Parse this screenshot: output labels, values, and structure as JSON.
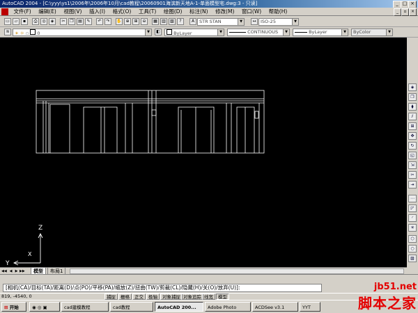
{
  "window": {
    "title": "AutoCAD 2004 - [C:\\yyy\\ys1\\2006年\\2006年10月\\cad教程\\20060901海滨新天地A-1-单面模型宅.dwg:3 - 只读]"
  },
  "menu": {
    "items": [
      "文件(F)",
      "编辑(E)",
      "视图(V)",
      "插入(I)",
      "格式(O)",
      "工具(T)",
      "绘图(D)",
      "标注(N)",
      "修改(M)",
      "窗口(W)",
      "帮助(H)"
    ]
  },
  "toolbar1": {
    "textstyle": "STR STAN",
    "dimstyle": "ISO-25"
  },
  "toolbar2": {
    "layer": "0",
    "color": "ByLayer",
    "linetype": "CONTINUOUS",
    "lineweight": "ByLayer",
    "plotstyle": "ByColor"
  },
  "ucs": {
    "x_label": "X",
    "y_label": "Y",
    "z_label": "Z"
  },
  "tabs": {
    "model": "模型",
    "layout": "布局1"
  },
  "command": {
    "prompt": "[相机(CA)/目标(TA)/距离(D)/点(PO)/平移(PA)/缩放(Z)/扭曲(TW)/剪裁(CL)/隐藏(H)/关(O)/放弃(U)]:"
  },
  "status": {
    "coords": "819, -4540, 0",
    "buttons": [
      "捕捉",
      "栅格",
      "正交",
      "极轴",
      "对象捕捉",
      "对象追踪",
      "线宽",
      "模型"
    ]
  },
  "taskbar": {
    "start": "开始",
    "tasks": [
      "cad建模教程",
      "cad教程",
      "AutoCAD 200...",
      "Adobe Photo",
      "ACDSee v3.1",
      "YYT"
    ]
  },
  "watermark": {
    "site": "jb51.net",
    "name": "脚本之家"
  },
  "colors": {
    "title_bar": "#0a246a",
    "canvas": "#000000",
    "drawing_lines": "#ffffff",
    "watermark": "#e40000"
  }
}
